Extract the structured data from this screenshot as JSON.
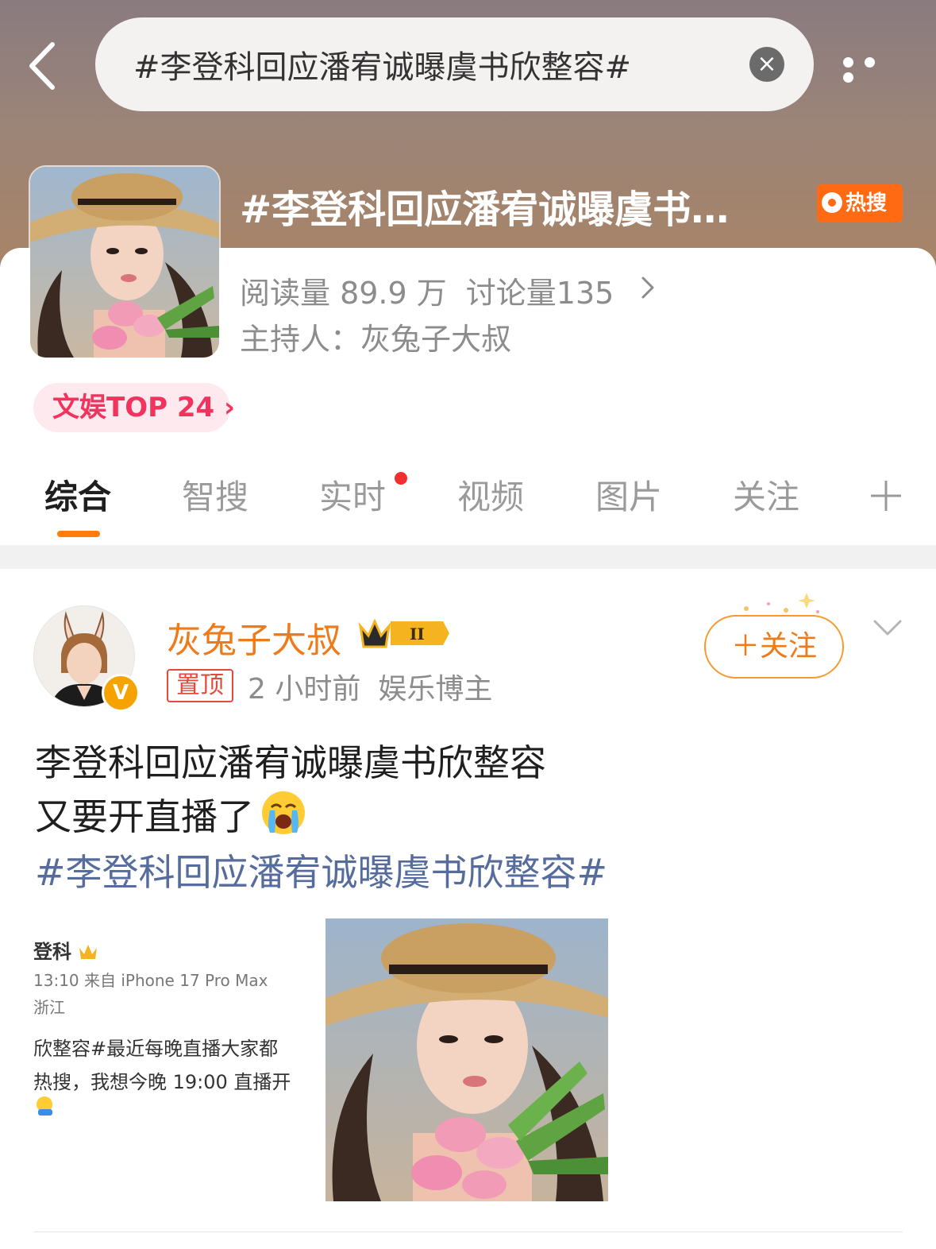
{
  "search": {
    "query": "#李登科回应潘宥诚曝虞书欣整容#",
    "clear_symbol": "×"
  },
  "topic": {
    "title": "#李登科回应潘宥诚曝虞书…",
    "hot_badge": "热搜",
    "reads": "阅读量 89.9 万",
    "discussions": "讨论量135",
    "host": "主持人：灰兔子大叔",
    "rank": "文娱TOP 24 ›"
  },
  "tabs": [
    "综合",
    "智搜",
    "实时",
    "视频",
    "图片",
    "关注"
  ],
  "active_tab": "综合",
  "post": {
    "author": "灰兔子大叔",
    "verified_mark": "V",
    "pin_label": "置顶",
    "time": "2 小时前",
    "role": "娱乐博主",
    "follow_label": "＋关注",
    "text_line1": "李登科回应潘宥诚曝虞书欣整容",
    "text_line2": "又要开直播了",
    "hashtag": "#李登科回应潘宥诚曝虞书欣整容#",
    "quoted_image": {
      "name": "登科",
      "time": "13:10  来自 iPhone 17 Pro Max",
      "location": "浙江",
      "line1": "欣整容#最近每晚直播大家都",
      "line2": "热搜，我想今晚 19:00 直播开"
    }
  },
  "colors": {
    "accent_orange": "#ff7c0a",
    "hot_badge": "#ff6a13",
    "link_blue": "#556c9d",
    "rank_pink": "#f2335d"
  }
}
